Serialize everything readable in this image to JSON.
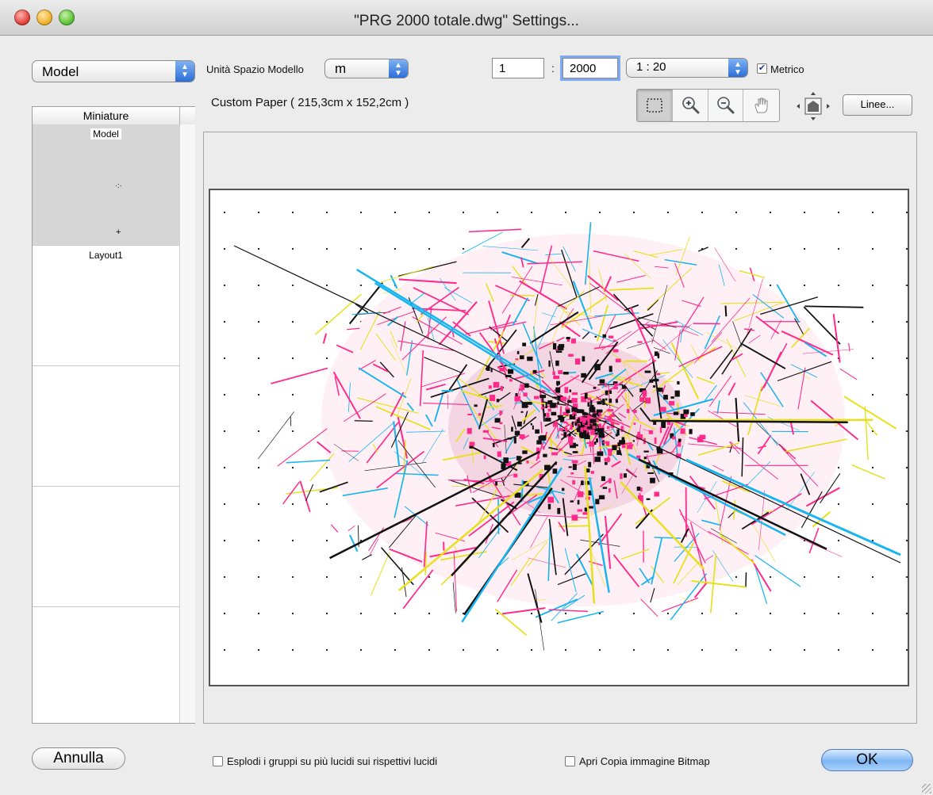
{
  "window": {
    "title": "\"PRG 2000 totale.dwg\" Settings..."
  },
  "top": {
    "space_select": "Model",
    "units_label": "Unità Spazio Modello",
    "units_value": "m",
    "scale_left": "1",
    "scale_colon": ":",
    "scale_right": "2000",
    "scale_preset": "1 : 20",
    "metric_label": "Metrico",
    "metric_checked": true
  },
  "paper_info": "Custom Paper ( 215,3cm x 152,2cm )",
  "sidebar": {
    "header": "Miniature",
    "items": [
      {
        "label": "Model",
        "selected": true
      },
      {
        "label": "Layout1",
        "selected": false
      }
    ]
  },
  "toolbar": {
    "tools": [
      {
        "icon": "marquee-select-icon",
        "active": true
      },
      {
        "icon": "zoom-in-icon",
        "active": false
      },
      {
        "icon": "zoom-out-icon",
        "active": false
      },
      {
        "icon": "hand-pan-icon",
        "active": false
      }
    ],
    "linee_button": "Linee..."
  },
  "bottom": {
    "cancel": "Annulla",
    "explode_groups": "Esplodi i gruppi su più lucidi sui rispettivi lucidi",
    "open_bitmap": "Apri Copia immagine Bitmap",
    "ok": "OK"
  },
  "colors": {
    "map_black": "#111111",
    "map_magenta": "#ff2a8a",
    "map_cyan": "#19b5f0",
    "map_yellow": "#e7e01a",
    "accent_blue": "#2d6fd8"
  }
}
